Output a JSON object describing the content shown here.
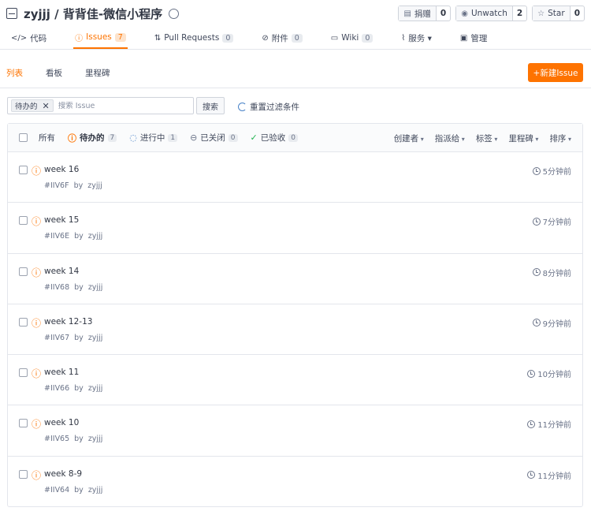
{
  "repo": {
    "title": "zyjjj / 背背佳-微信小程序"
  },
  "actions": [
    {
      "label": "捐赠",
      "count": "0"
    },
    {
      "label": "Unwatch",
      "count": "2"
    },
    {
      "label": "Star",
      "count": "0"
    }
  ],
  "tabs": [
    {
      "label": "代码",
      "icon": "code-icon"
    },
    {
      "label": "Issues",
      "count": "7",
      "icon": "issue-icon"
    },
    {
      "label": "Pull Requests",
      "count": "0",
      "icon": "pull-request-icon"
    },
    {
      "label": "附件",
      "count": "0",
      "icon": "attachment-icon"
    },
    {
      "label": "Wiki",
      "count": "0",
      "icon": "wiki-icon"
    },
    {
      "label": "服务 ▾",
      "icon": "service-icon"
    },
    {
      "label": "管理",
      "icon": "manage-icon"
    }
  ],
  "subnav": {
    "list": "列表",
    "board": "看板",
    "milestone": "里程碑"
  },
  "new_issue_label": "+新建Issue",
  "filter": {
    "chip": "待办的",
    "placeholder": "搜索 Issue",
    "search_label": "搜索",
    "reset_label": "重置过滤条件"
  },
  "states": {
    "all": "所有",
    "open": {
      "label": "待办的",
      "count": "7"
    },
    "progress": {
      "label": "进行中",
      "count": "1"
    },
    "closed": {
      "label": "已关闭",
      "count": "0"
    },
    "accepted": {
      "label": "已验收",
      "count": "0"
    }
  },
  "sorters": [
    "创建者",
    "指派给",
    "标签",
    "里程碑",
    "排序"
  ],
  "issues": [
    {
      "title": "week 16",
      "id": "#IIV6F",
      "by": "by",
      "author": "zyjjj",
      "time": "5分钟前"
    },
    {
      "title": "week 15",
      "id": "#IIV6E",
      "by": "by",
      "author": "zyjjj",
      "time": "7分钟前"
    },
    {
      "title": "week 14",
      "id": "#IIV68",
      "by": "by",
      "author": "zyjjj",
      "time": "8分钟前"
    },
    {
      "title": "week 12-13",
      "id": "#IIV67",
      "by": "by",
      "author": "zyjjj",
      "time": "9分钟前"
    },
    {
      "title": "week 11",
      "id": "#IIV66",
      "by": "by",
      "author": "zyjjj",
      "time": "10分钟前"
    },
    {
      "title": "week 10",
      "id": "#IIV65",
      "by": "by",
      "author": "zyjjj",
      "time": "11分钟前"
    },
    {
      "title": "week 8-9",
      "id": "#IIV64",
      "by": "by",
      "author": "zyjjj",
      "time": "11分钟前"
    }
  ],
  "colors": {
    "accent": "#fe7300",
    "progress": "#4a83c8",
    "accepted": "#21b351"
  }
}
